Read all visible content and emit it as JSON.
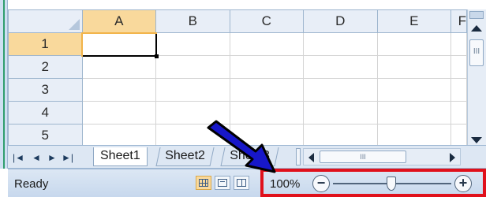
{
  "columns": [
    "A",
    "B",
    "C",
    "D",
    "E",
    "F"
  ],
  "rows": [
    "1",
    "2",
    "3",
    "4",
    "5"
  ],
  "active_cell": "A1",
  "sheet_nav": {
    "first_label": "|◄",
    "prev_label": "◄",
    "next_label": "►",
    "last_label": "►|"
  },
  "sheets": [
    "Sheet1",
    "Sheet2",
    "Sheet3"
  ],
  "scroll_grip": "III",
  "status": {
    "ready_label": "Ready",
    "zoom_level": "100%",
    "zoom_out_label": "−",
    "zoom_in_label": "+"
  },
  "colors": {
    "highlight": "#e0101b",
    "arrow": "#1717c9",
    "active_header": "#f9d99c"
  }
}
